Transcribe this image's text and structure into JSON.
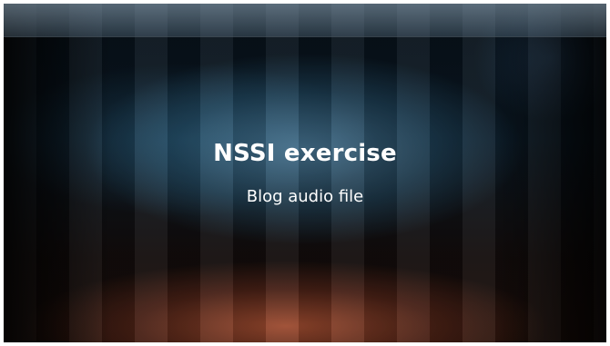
{
  "slide": {
    "title": "NSSI exercise",
    "subtitle": "Blog audio file"
  },
  "colors": {
    "background": "#000000",
    "text": "#ffffff",
    "glow_blue": "#5f96b9",
    "glow_orange": "#c85f3c"
  }
}
